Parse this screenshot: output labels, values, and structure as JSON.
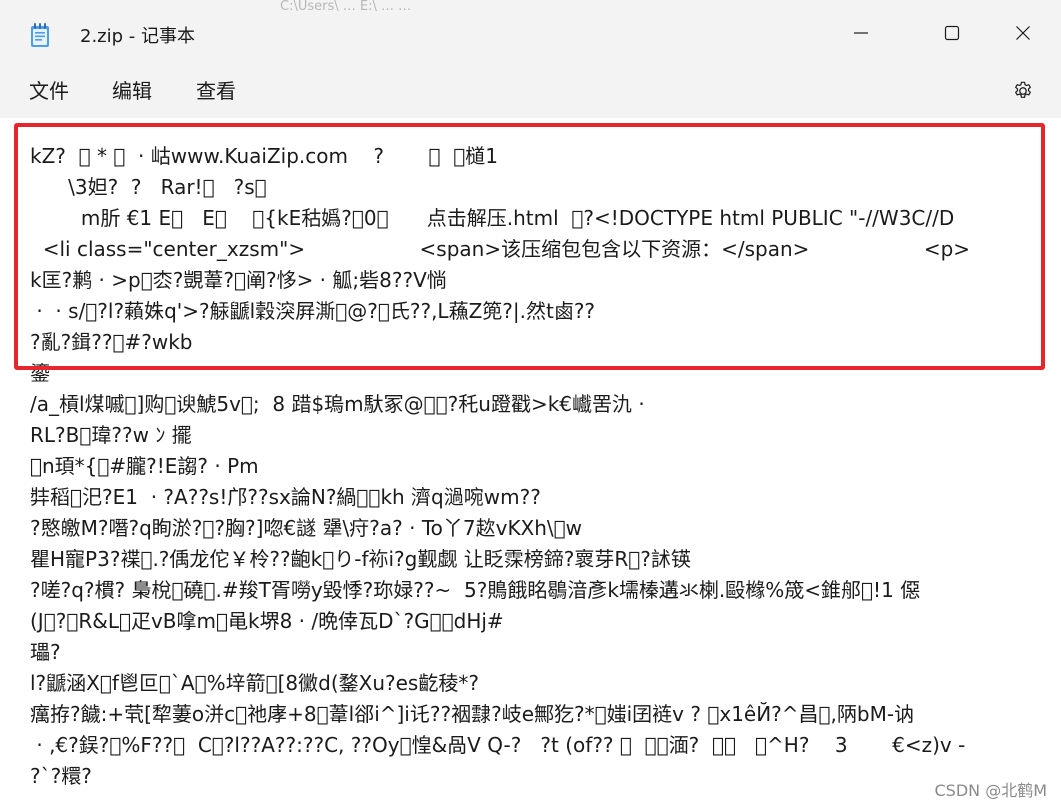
{
  "window": {
    "title": "2.zip - 记事本",
    "background_tab_fragment": "C:\\Users\\ …  E:\\ …  …"
  },
  "menu": {
    "items": [
      "文件",
      "编辑",
      "查看"
    ]
  },
  "icons": {
    "app": "notepad-icon",
    "minimize": "minimize-icon",
    "maximize": "maximize-icon",
    "close": "close-icon",
    "settings": "gear-icon"
  },
  "editor": {
    "lines": [
      "kZ?  \u0000 * \u0000  · 岵www.KuaiZip.com    ?       \u0000  \u0000檤1",
      "      \\3妲?  ?   Rar!\u0000   ?s\u0000",
      "        m肵 €1 E\u0000   E\u0000    \u0000{kE秙嬀?\u00000\u0000      点击解压.html  \u0000?<!DOCTYPE html PUBLIC \"-//W3C//D",
      "  <li class=\"center_xzsm\">                  <span>该压缩包包含以下资源：</span>                  <p>",
      "k匡?鹣 · >p\u0000枩?覬葦?\u0000阐?恀> · 觚;砦8??V惝",
      " ·  · s/\u0000?l?藾姝q'>?觨鼶l穀湥屛澌\u0000@?\u0000氏??,L蘓Z篼?|.然t鹵??",
      "?亂?鍓??\u0000#?wkb",
      "鎏",
      "/a_槓l煤嘁\u0000]购\u0000谀鯱5v\u0000;  8 踖$瑦m馱冢@\u0000\u0000?秅u蹬戳>k€巇罟氿 ·",
      "RL?B\u0000瑋??w ﾝ 擺",
      "\u0000n頊*{\u0000#朧?!E謅? · Pm",
      "弉稻\u0000汜?E1  · ?A??s!邝??sx論N?緺\u0000\u0000kh 濟q濄啘wm??",
      "?愍皦M?噆?q眴淤?\u0000?胸?]唿€譢 犟\\疛?a? · To丫7趑vKXh\\\u0000w",
      "瞿H寵P3?褋\u0000.?偊龙佗￥柃??齙k\u0000り-f袮i?g觐觑 让眨霂榜鍗?褱芽R\u0000?訹锳",
      "?嗟?q?樌? 梟梲\u0000磽\u0000.#羧T胥嘮y毀悸?珎娽??~  5?鵙餓眳鶡湆彥k壖榛遘氺楋.毆橼%筬<錐郍\u0000!1 僫",
      "(J\u0000?\u0000R&L\u0000疋vB嗱m\u0000黾k堺8 · /晩倖瓦D`?G\u0000\u0000dHj#",
      "瓃?",
      "l?鼶涵X\u0000f鬯叵\u0000`A\u0000%垶箭\u0000[8黴d(鍪Xu?es齕稜*?",
      "癘拵?饖:+茕[犂萋o洴c\u0000祂庨+8\u0000葦l郤i^]i讬??裀霴?岐e鄦犵?*\u0000媸i囝裢v ? \u0000x1êЙ?^昌\u0000,陃bM-讷",
      " · ,€?鋘?\u0000%F??\u0000  C\u0000?l??A??:??C, ??Oy\u0000惶&咼V Q-?   ?t (of?? \u0000  \u0000\u0000湎?  \u0000\u0000   \u0000^H?    3       €<z)v -",
      "?`?糫?"
    ]
  },
  "watermark": "CSDN @北鹤M",
  "colors": {
    "window_bg": "#f3f3f3",
    "editor_bg": "#ffffff",
    "highlight": "#e5262b",
    "text": "#1b1b1b"
  }
}
